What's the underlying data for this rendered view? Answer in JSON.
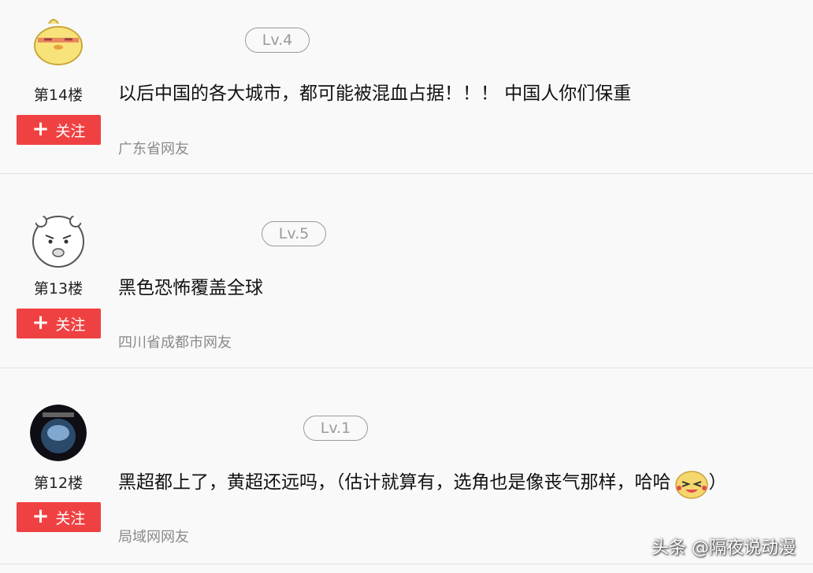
{
  "comments": [
    {
      "level": "Lv.4",
      "floor": "第14楼",
      "follow_label": "关注",
      "text": "以后中国的各大城市，都可能被混血占据！！！ 中国人你们保重",
      "location": "广东省网友"
    },
    {
      "level": "Lv.5",
      "floor": "第13楼",
      "follow_label": "关注",
      "text": "黑色恐怖覆盖全球",
      "location": "四川省成都市网友"
    },
    {
      "level": "Lv.1",
      "floor": "第12楼",
      "follow_label": "关注",
      "text": "黑超都上了，黄超还远吗，（估计就算有，选角也是像丧气那样，哈哈",
      "text_tail": "）",
      "location": "局域网网友"
    }
  ],
  "watermark": "头条 @隔夜说动漫",
  "colors": {
    "follow_button": "#f04142",
    "background": "#f9f9f9",
    "badge_border": "#9a9a9a"
  }
}
